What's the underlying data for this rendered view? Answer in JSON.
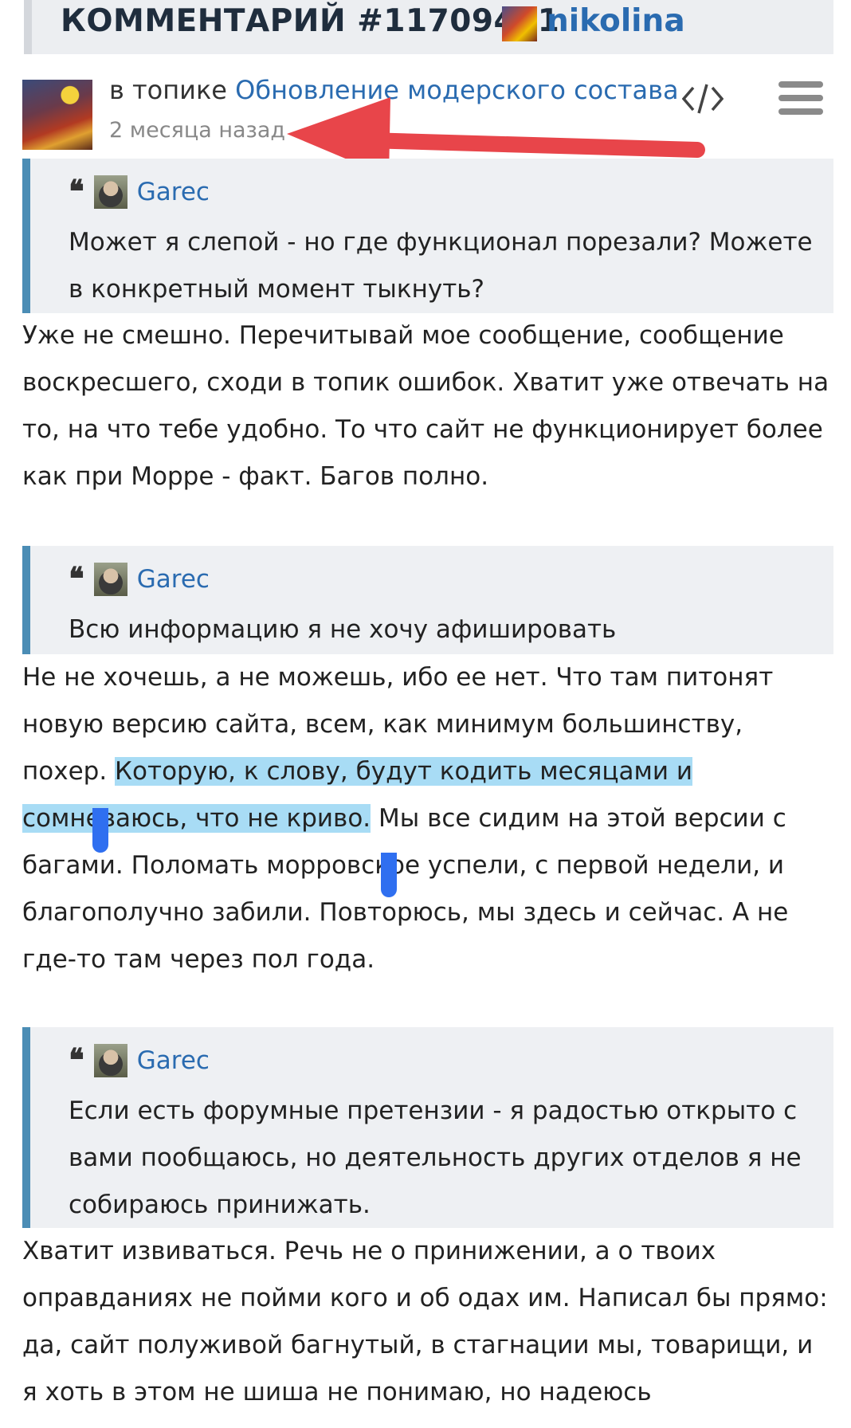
{
  "header": {
    "title": "КОММЕНТАРИЙ #11709451",
    "username": "nikolina"
  },
  "meta": {
    "topic_prefix": "в топике",
    "topic_link": "Обновление модерского состава",
    "time": "2 месяца назад"
  },
  "icons": {
    "code": "code-icon",
    "menu": "hamburger-menu-icon",
    "arrow": "red-arrow-annotation"
  },
  "colors": {
    "link": "#2a6bb0",
    "quote_bar": "#4b8db5",
    "quote_bg": "#eef0f3",
    "selection": "#a8dcf5",
    "arrow": "#e8454a"
  },
  "quotes": [
    {
      "author": "Garec",
      "text": "Может я слепой - но где функционал порезали? Можете в конкретный момент тыкнуть?"
    },
    {
      "author": "Garec",
      "text": "Всю информацию я не хочу афишировать"
    },
    {
      "author": "Garec",
      "text": "Если есть форумные претензии - я радостью открыто с вами пообщаюсь, но деятельность других отделов я не собираюсь принижать."
    }
  ],
  "replies": {
    "r1": "Уже не смешно. Перечитывай мое сообщение, сообщение воскресшего, сходи в топик ошибок. Хватит уже отвечать на то, на что тебе удобно. То что сайт не функционирует более как при Морре - факт. Багов полно.",
    "r2_before": "Не не хочешь, а не можешь, ибо ее нет. Что там питонят новую версию сайта, всем, как минимум большинству, похер. ",
    "r2_selected": "Которую, к слову, будут кодить месяцами и сомневаюсь, что не криво.",
    "r2_after": " Мы все сидим на этой версии с багами. Поломать морровское успели, с первой недели, и благополучно забили. Повторюсь, мы здесь и сейчас. А не где-то там через пол года.",
    "r3": "Хватит извиваться. Речь не о принижении, а о твоих оправданиях не пойми кого и об одах им. Написал бы прямо: да, сайт полуживой багнутый, в стагнации мы, товарищи, и я хоть в этом не шиша не понимаю, но надеюсь"
  }
}
